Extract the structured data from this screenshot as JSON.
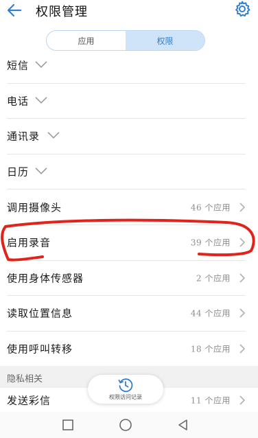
{
  "header": {
    "title": "权限管理",
    "back_icon": "back-arrow-icon",
    "settings_icon": "gear-icon"
  },
  "tabs": [
    {
      "label": "应用",
      "active": false
    },
    {
      "label": "权限",
      "active": true
    }
  ],
  "permissions": [
    {
      "label": "短信",
      "expandable": true
    },
    {
      "label": "电话",
      "expandable": true
    },
    {
      "label": "通讯录",
      "expandable": true
    },
    {
      "label": "日历",
      "expandable": true
    },
    {
      "label": "调用摄像头",
      "count": "46 个应用"
    },
    {
      "label": "启用录音",
      "count": "39 个应用"
    },
    {
      "label": "使用身体传感器",
      "count": "2 个应用"
    },
    {
      "label": "读取位置信息",
      "count": "44 个应用"
    },
    {
      "label": "使用呼叫转移",
      "count": "18 个应用"
    }
  ],
  "privacy_section": {
    "label": "隐私相关",
    "items": [
      {
        "label": "发送彩信",
        "count": "11 个应用"
      }
    ]
  },
  "fab": {
    "label": "权限访问记录",
    "icon": "history-clock-icon"
  },
  "colors": {
    "accent": "#2f7fd0",
    "tab_active_bg": "#cfe4f8",
    "annotation": "#e0231b"
  },
  "navbar": {
    "icons": [
      "back-triangle-icon",
      "home-circle-icon",
      "recents-square-icon"
    ]
  }
}
